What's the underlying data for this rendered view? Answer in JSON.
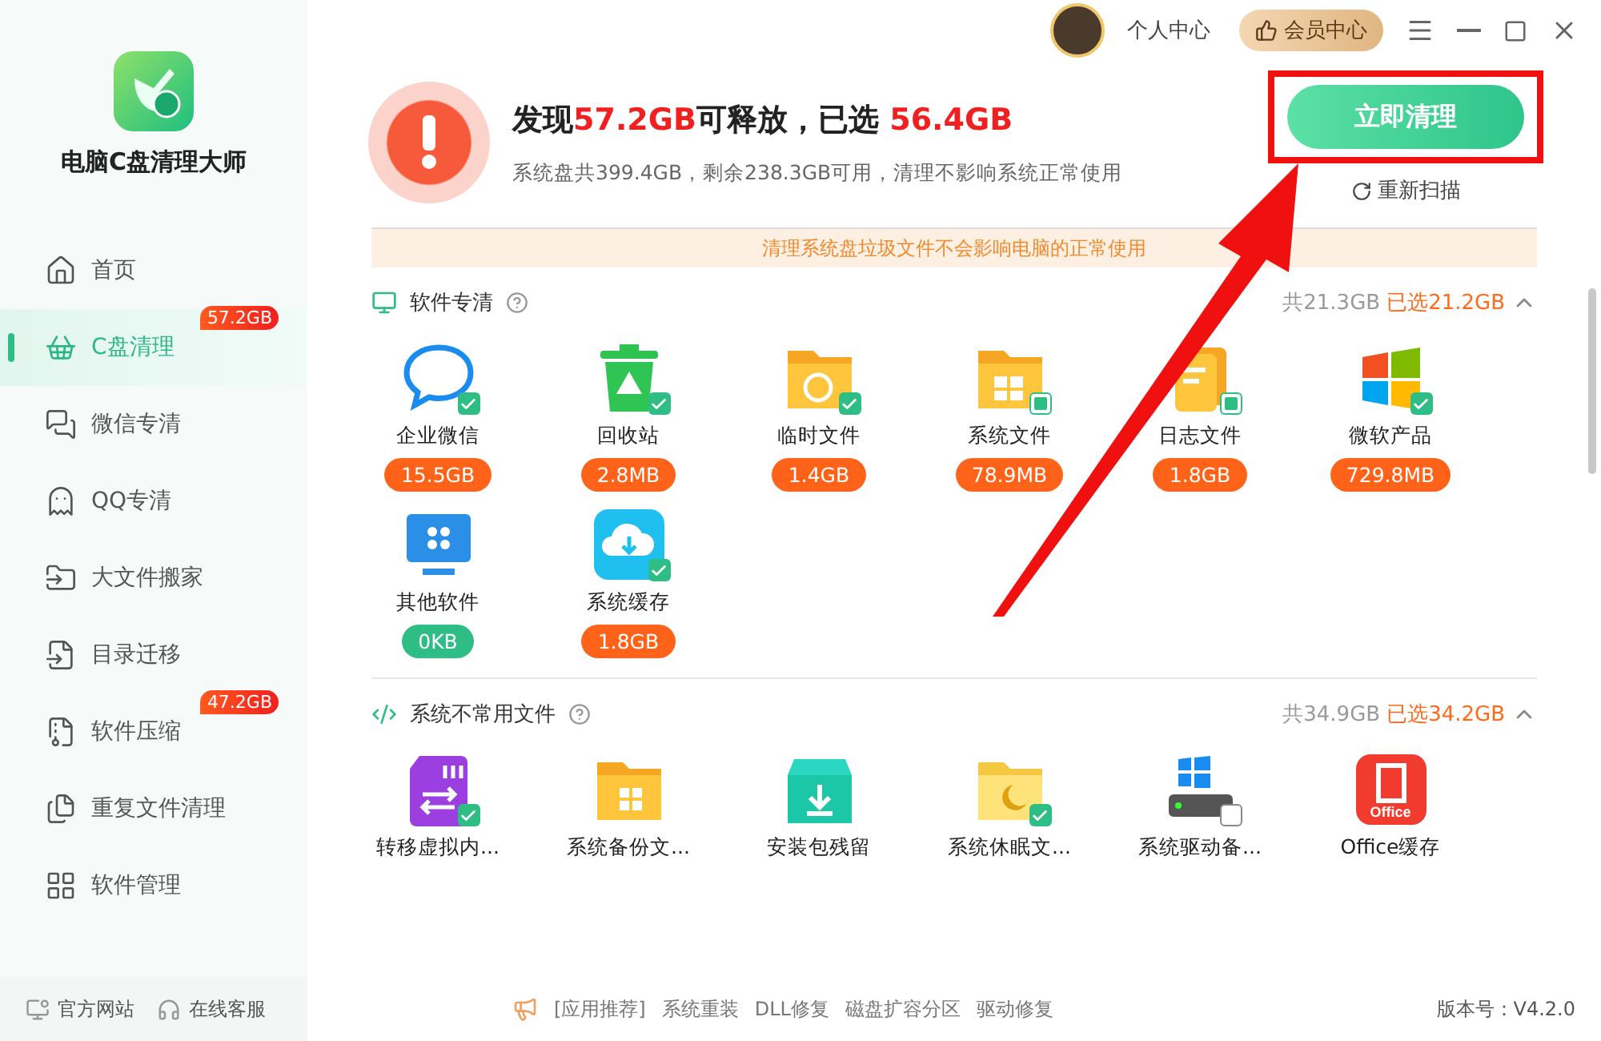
{
  "app": {
    "name": "电脑C盘清理大师"
  },
  "sidebar": {
    "items": [
      {
        "label": "首页",
        "selected": false
      },
      {
        "label": "C盘清理",
        "selected": true,
        "badge": "57.2GB"
      },
      {
        "label": "微信专清",
        "selected": false
      },
      {
        "label": "QQ专清",
        "selected": false
      },
      {
        "label": "大文件搬家",
        "selected": false
      },
      {
        "label": "目录迁移",
        "selected": false
      },
      {
        "label": "软件压缩",
        "selected": false,
        "badge": "47.2GB"
      },
      {
        "label": "重复文件清理",
        "selected": false
      },
      {
        "label": "软件管理",
        "selected": false
      }
    ]
  },
  "titlebar": {
    "user": "个人中心",
    "vip": "会员中心"
  },
  "summary": {
    "headline": [
      {
        "text": "发现",
        "highlight": false
      },
      {
        "text": "57.2GB",
        "highlight": true
      },
      {
        "text": "可释放，已选 ",
        "highlight": false
      },
      {
        "text": "56.4GB",
        "highlight": true
      }
    ],
    "detail": "系统盘共399.4GB，剩余238.3GB可用，清理不影响系统正常使用",
    "action": "立即清理",
    "rescan": "重新扫描"
  },
  "notice": "清理系统盘垃圾文件不会影响电脑的正常使用",
  "sections": [
    {
      "title": "软件专清",
      "total": "共21.3GB",
      "selected": "已选21.2GB",
      "expanded": true,
      "items": [
        {
          "label": "企业微信",
          "size": "15.5GB",
          "color": "#ff6319",
          "checked": true
        },
        {
          "label": "回收站",
          "size": "2.8MB",
          "color": "#ff6319",
          "checked": true
        },
        {
          "label": "临时文件",
          "size": "1.4GB",
          "color": "#ff6319",
          "checked": true
        },
        {
          "label": "系统文件",
          "size": "78.9MB",
          "color": "#ff6319",
          "checked": false,
          "partial": true
        },
        {
          "label": "日志文件",
          "size": "1.8GB",
          "color": "#ff6319",
          "checked": false,
          "partial": true
        },
        {
          "label": "微软产品",
          "size": "729.8MB",
          "color": "#ff6319",
          "checked": true
        },
        {
          "label": "其他软件",
          "size": "0KB",
          "color": "#2ebd85"
        },
        {
          "label": "系统缓存",
          "size": "1.8GB",
          "color": "#ff6319",
          "checked": true
        }
      ]
    },
    {
      "title": "系统不常用文件",
      "total": "共34.9GB",
      "selected": "已选34.2GB",
      "expanded": true,
      "items": [
        {
          "label": "转移虚拟内...",
          "checked": true
        },
        {
          "label": "系统备份文..."
        },
        {
          "label": "安装包残留"
        },
        {
          "label": "系统休眠文...",
          "checked": true
        },
        {
          "label": "系统驱动备...",
          "checked": false,
          "partial": false
        },
        {
          "label": "Office缓存",
          "icon_text": "Office"
        }
      ]
    }
  ],
  "footer": {
    "links": [
      "官方网站",
      "在线客服"
    ],
    "recommend": [
      "[应用推荐]",
      "系统重装",
      "DLL修复",
      "磁盘扩容分区",
      "驱动修复"
    ],
    "version": "版本号：V4.2.0"
  }
}
